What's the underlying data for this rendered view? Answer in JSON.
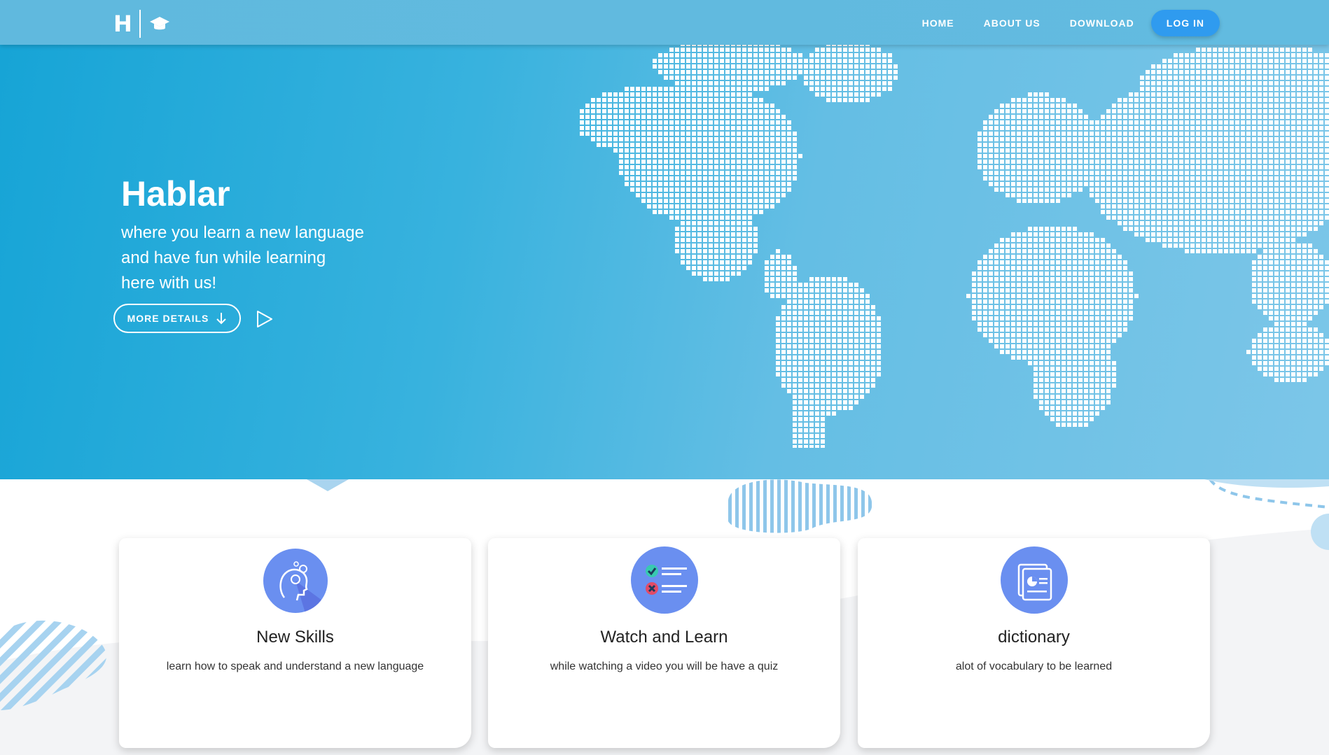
{
  "nav": {
    "logo_letter": "H",
    "links": [
      "HOME",
      "ABOUT US",
      "DOWNLOAD"
    ],
    "login": "LOG IN"
  },
  "hero": {
    "title": "Hablar",
    "lines": [
      "where you learn a new language",
      "and have fun while learning",
      "here with us!"
    ],
    "more_details": "MORE DETAILS"
  },
  "features": [
    {
      "title": "New Skills",
      "description": "learn how to speak and understand a new language",
      "icon": "head-gears-icon"
    },
    {
      "title": "Watch and Learn",
      "description": "while watching a video you will be have a quiz",
      "icon": "quiz-checklist-icon"
    },
    {
      "title": "dictionary",
      "description": "alot of vocabulary to be learned",
      "icon": "documents-icon"
    }
  ],
  "colors": {
    "hero_start": "#16a4d6",
    "hero_end": "#7cc6e8",
    "login_button": "#2f9bef",
    "icon_circle": "#6a8ff0"
  }
}
